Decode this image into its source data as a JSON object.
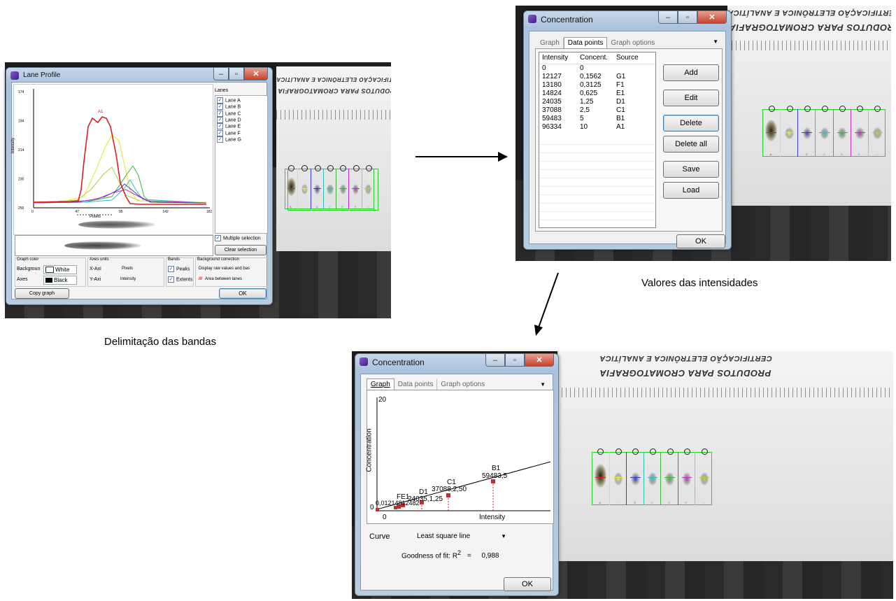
{
  "lane_profile": {
    "title": "Lane Profile",
    "lanes_label": "Lanes",
    "lanes": [
      "Lane A",
      "Lane B",
      "Lane C",
      "Lane D",
      "Lane E",
      "Lane F",
      "Lane G"
    ],
    "y_axis_label": "Intensity",
    "y_ticks": [
      "174",
      "194",
      "214",
      "235",
      "255"
    ],
    "x_ticks": [
      "0",
      "47",
      "95",
      "142",
      "181"
    ],
    "x_axis_label": "Pixels",
    "peak_label": "A1",
    "multiple_selection_label": "Multiple selection",
    "clear_selection_label": "Clear selection",
    "graph_color": {
      "title": "Graph color",
      "background_label": "Backgroun",
      "background_value": "White",
      "axes_label": "Axes",
      "axes_value": "Black"
    },
    "axes_units": {
      "title": "Axes units",
      "x_label": "X-Axi",
      "x_value": "Pixels",
      "y_label": "Y-Axi",
      "y_value": "Intensity"
    },
    "bands": {
      "title": "Bands",
      "peaks_label": "Peaks",
      "extents_label": "Extents"
    },
    "background_correction": {
      "title": "Background correction",
      "mode_value": "Display raw values and bas",
      "method_value": "Area between lanes"
    },
    "copy_graph_label": "Copy graph",
    "ok_label": "OK"
  },
  "concentration_data": {
    "title": "Concentration",
    "tabs": [
      "Graph",
      "Data points",
      "Graph options"
    ],
    "columns": [
      "Intensity",
      "Concent.",
      "Source"
    ],
    "rows": [
      [
        "0",
        "0",
        ""
      ],
      [
        "12127",
        "0,1562",
        "G1"
      ],
      [
        "13180",
        "0,3125",
        "F1"
      ],
      [
        "14824",
        "0,625",
        "E1"
      ],
      [
        "24035",
        "1,25",
        "D1"
      ],
      [
        "37088",
        "2,5",
        "C1"
      ],
      [
        "59483",
        "5",
        "B1"
      ],
      [
        "96334",
        "10",
        "A1"
      ]
    ],
    "buttons": {
      "add": "Add",
      "edit": "Edit",
      "delete": "Delete",
      "delete_all": "Delete all",
      "save": "Save",
      "load": "Load",
      "ok": "OK"
    }
  },
  "concentration_graph": {
    "title": "Concentration",
    "tabs": [
      "Graph",
      "Data points",
      "Graph options"
    ],
    "y_axis_label": "Concentration",
    "x_axis_label": "Intensity",
    "y_top_tick": "20",
    "origin_tick": "0",
    "point_labels": {
      "b1_name": "B1",
      "b1_value": "59483,5",
      "c1_name": "C1",
      "c1_value": "37088,2,50",
      "d1_name": "D1",
      "d1_value": "24035,1,25",
      "e1_name": "FE1",
      "cluster_text": "0,01214812482"
    },
    "curve_label": "Curve",
    "curve_value": "Least square line",
    "goodness_label": "Goodness of fit: R",
    "goodness_sup": "2",
    "goodness_eq": "=",
    "goodness_value": "0,988",
    "ok_label": "OK"
  },
  "plate": {
    "text_line1": "CERTIFICAÇÃO ELETRÔNICA E ANALÍTICA",
    "text_line2": "PRODUTOS PARA CROMATOGRAFIA",
    "lane_letters": [
      "A",
      "B",
      "C",
      "D",
      "E",
      "F",
      "G"
    ]
  },
  "captions": {
    "delimitacao": "Delimitação das bandas",
    "valores": "Valores das intensidades"
  },
  "colors": {
    "lane_a": "#d42020",
    "lane_b": "#e8e84a",
    "lane_c": "#3a3ad0",
    "lane_d": "#30c0c0",
    "lane_e": "#3ab83a",
    "lane_f": "#c030c0",
    "lane_g": "#b0d040",
    "frame": "#2ad12a"
  }
}
